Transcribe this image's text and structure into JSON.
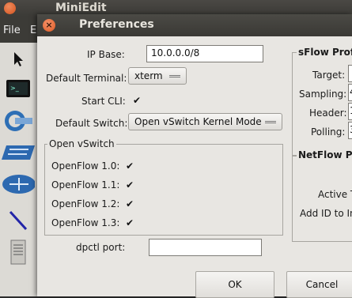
{
  "background_app": {
    "title": "MiniEdit",
    "menu": [
      "File",
      "E"
    ]
  },
  "dialog": {
    "title": "Preferences",
    "ip_base": {
      "label": "IP Base:",
      "value": "10.0.0.0/8"
    },
    "default_terminal": {
      "label": "Default Terminal:",
      "value": "xterm"
    },
    "start_cli": {
      "label": "Start CLI:",
      "checked": true
    },
    "default_switch": {
      "label": "Default Switch:",
      "value": "Open vSwitch Kernel Mode"
    },
    "openvswitch": {
      "title": "Open vSwitch",
      "items": [
        {
          "label": "OpenFlow 1.0:",
          "checked": true
        },
        {
          "label": "OpenFlow 1.1:",
          "checked": true
        },
        {
          "label": "OpenFlow 1.2:",
          "checked": true
        },
        {
          "label": "OpenFlow 1.3:",
          "checked": true
        }
      ]
    },
    "dpctl_port": {
      "label": "dpctl port:",
      "value": ""
    },
    "sflow": {
      "title": "sFlow Profil",
      "target_label": "Target:",
      "sampling_label": "Sampling:",
      "sampling_value": "4",
      "header_label": "Header:",
      "header_value": "1",
      "polling_label": "Polling:",
      "polling_value": "3"
    },
    "netflow": {
      "title": "NetFlow Pro",
      "active_label": "Active T",
      "add_id_label": "Add ID to In"
    },
    "ok_label": "OK",
    "cancel_label": "Cancel",
    "check_glyph": "✔"
  }
}
